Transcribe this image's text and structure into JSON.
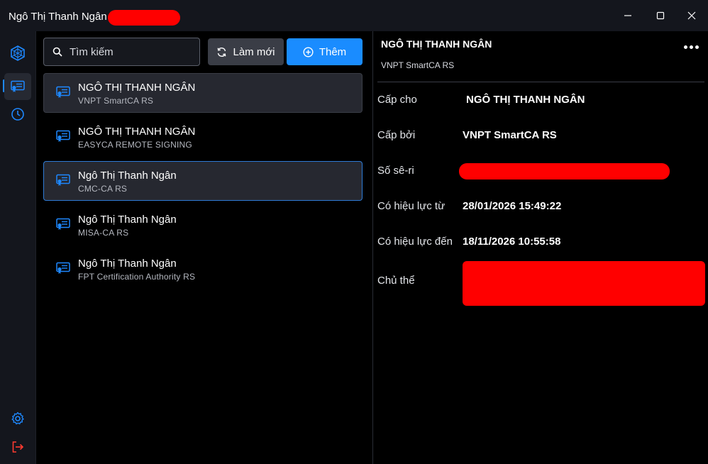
{
  "window": {
    "title": "Ngô Thị Thanh Ngân",
    "controls": [
      "minimize-icon",
      "maximize-icon",
      "close-icon"
    ]
  },
  "rail": {
    "items": [
      {
        "name": "app-logo-icon"
      },
      {
        "name": "certificate-icon",
        "active": true
      },
      {
        "name": "history-icon"
      },
      {
        "name": "settings-icon"
      },
      {
        "name": "logout-icon"
      }
    ]
  },
  "toolbar": {
    "search_placeholder": "Tìm kiếm",
    "refresh_label": "Làm mới",
    "add_label": "Thêm"
  },
  "certificates": [
    {
      "name": "NGÔ THỊ THANH NGÂN",
      "issuer": "VNPT SmartCA RS"
    },
    {
      "name": "NGÔ THỊ THANH NGÂN",
      "issuer": "EASYCA REMOTE SIGNING"
    },
    {
      "name": "Ngô Thị Thanh Ngân",
      "issuer": "CMC-CA RS"
    },
    {
      "name": "Ngô Thị Thanh Ngân",
      "issuer": "MISA-CA RS"
    },
    {
      "name": "Ngô Thị Thanh Ngân",
      "issuer": "FPT Certification Authority RS"
    }
  ],
  "detail": {
    "title": "NGÔ THỊ THANH NGÂN",
    "subtitle": "VNPT SmartCA RS",
    "fields": {
      "issued_to_label": "Cấp cho",
      "issued_to": "NGÔ THỊ THANH NGÂN",
      "issued_by_label": "Cấp bởi",
      "issued_by": "VNPT SmartCA RS",
      "serial_label": "Số sê-ri",
      "valid_from_label": "Có hiệu lực từ",
      "valid_from": "28/01/2026 15:49:22",
      "valid_to_label": "Có hiệu lực đến",
      "valid_to": "18/11/2026 10:55:58",
      "subject_label": "Chủ thể"
    }
  },
  "colors": {
    "accent": "#1a8cff",
    "selected_border": "#2e7bd6",
    "redaction": "#ff0000"
  }
}
